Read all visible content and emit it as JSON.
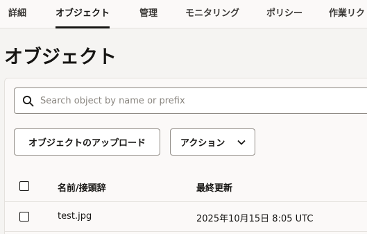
{
  "tabs": [
    {
      "label": "詳細"
    },
    {
      "label": "オブジェクト",
      "active": true
    },
    {
      "label": "管理"
    },
    {
      "label": "モニタリング"
    },
    {
      "label": "ポリシー"
    },
    {
      "label": "作業リク"
    }
  ],
  "page_title": "オブジェクト",
  "search": {
    "placeholder": "Search object by name or prefix",
    "value": ""
  },
  "toolbar": {
    "upload_label": "オブジェクトのアップロード",
    "actions_label": "アクション"
  },
  "table": {
    "columns": [
      "名前/接頭辞",
      "最終更新"
    ],
    "rows": [
      {
        "name": "test.jpg",
        "last_modified": "2025年10月15日 8:05 UTC",
        "checked": false
      }
    ]
  },
  "icons": {
    "search": "search-icon",
    "dropdown": "chevron-down-icon",
    "select": "checkbox"
  },
  "colors": {
    "background": "#f5f4f2",
    "panel": "#fbf9f8",
    "text": "#161513",
    "border": "#8f8a84"
  }
}
